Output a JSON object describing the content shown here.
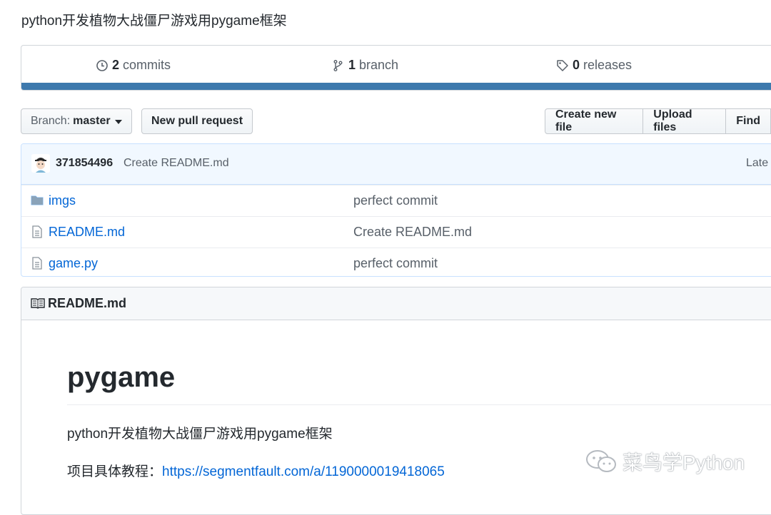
{
  "repo": {
    "description": "python开发植物大战僵尸游戏用pygame框架"
  },
  "summary": {
    "commits": {
      "count": "2",
      "label": "commits"
    },
    "branches": {
      "count": "1",
      "label": "branch"
    },
    "releases": {
      "count": "0",
      "label": "releases"
    },
    "language_bar_color": "#3d79ad"
  },
  "toolbar": {
    "branch_prefix": "Branch:",
    "branch_name": "master",
    "new_pr": "New pull request",
    "create_file": "Create new file",
    "upload_files": "Upload files",
    "find": "Find"
  },
  "commit": {
    "author": "371854496",
    "message": "Create README.md",
    "latest_label": "Late"
  },
  "files": [
    {
      "name": "imgs",
      "message": "perfect commit",
      "icon": "folder-icon"
    },
    {
      "name": "README.md",
      "message": "Create README.md",
      "icon": "file-icon"
    },
    {
      "name": "game.py",
      "message": "perfect commit",
      "icon": "file-icon"
    }
  ],
  "readme": {
    "header": "README.md",
    "title": "pygame",
    "paragraph1": "python开发植物大战僵尸游戏用pygame框架",
    "tutorial_label": "项目具体教程：",
    "tutorial_link": "https://segmentfault.com/a/1190000019418065"
  },
  "watermark": {
    "text": "菜鸟学Python"
  }
}
